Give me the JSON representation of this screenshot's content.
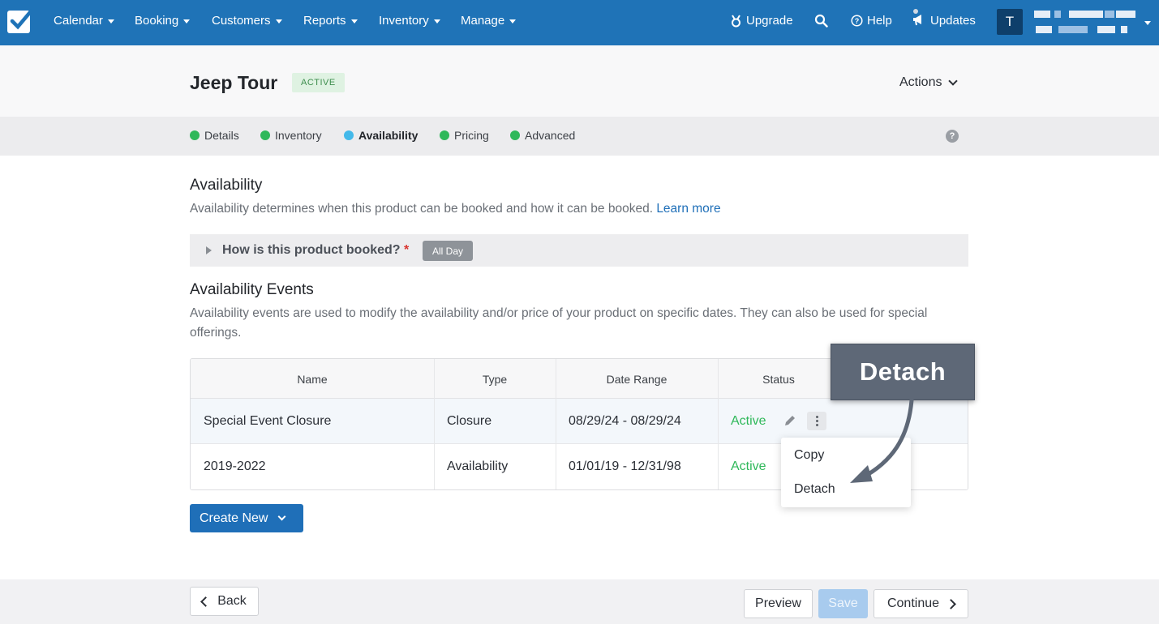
{
  "nav": {
    "items": [
      {
        "label": "Calendar"
      },
      {
        "label": "Booking"
      },
      {
        "label": "Customers"
      },
      {
        "label": "Reports"
      },
      {
        "label": "Inventory"
      },
      {
        "label": "Manage"
      }
    ],
    "upgrade": "Upgrade",
    "help": "Help",
    "updates": "Updates",
    "avatar_initial": "T"
  },
  "header": {
    "title": "Jeep Tour",
    "status_badge": "ACTIVE",
    "actions": "Actions"
  },
  "tabs": [
    {
      "label": "Details"
    },
    {
      "label": "Inventory"
    },
    {
      "label": "Availability"
    },
    {
      "label": "Pricing"
    },
    {
      "label": "Advanced"
    }
  ],
  "help_glyph": "?",
  "availability": {
    "heading": "Availability",
    "description": "Availability determines when this product can be booked and how it can be booked.",
    "learn_more": "Learn more",
    "booked_question": "How is this product booked?",
    "required_mark": "*",
    "booked_value": "All Day"
  },
  "events": {
    "heading": "Availability Events",
    "description": "Availability events are used to modify the availability and/or price of your product on specific dates. They can also be used for special offerings.",
    "columns": [
      "Name",
      "Type",
      "Date Range",
      "Status"
    ],
    "rows": [
      {
        "name": "Special Event Closure",
        "type": "Closure",
        "date_range": "08/29/24 - 08/29/24",
        "status": "Active"
      },
      {
        "name": "2019-2022",
        "type": "Availability",
        "date_range": "01/01/19 - 12/31/98",
        "status": "Active"
      }
    ],
    "menu": [
      "Copy",
      "Detach"
    ],
    "create_new": "Create New"
  },
  "callout": "Detach",
  "footer": {
    "back": "Back",
    "preview": "Preview",
    "save": "Save",
    "continue": "Continue"
  },
  "colors": {
    "brand_blue": "#1f73b7",
    "active_green": "#2fb85a",
    "current_tab_dot": "#43b9ea"
  }
}
